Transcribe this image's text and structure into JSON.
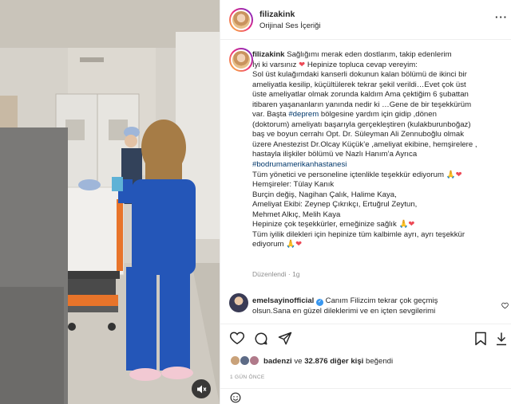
{
  "post": {
    "username": "filizakink",
    "audio": "Orijinal Ses İçeriği",
    "more_label": "···"
  },
  "caption": {
    "username": "filizakink",
    "lines": [
      " Sağlığımı merak eden dostlarım, takip edenlerim",
      "İyi ki varsınız ",
      " Hepinize topluca cevap vereyim:",
      "Sol üst kulağımdaki kanserli dokunun kalan bölümü de ikinci bir",
      "ameliyatla kesilip, küçültülerek tekrar şekil verildi…Evet çok üst",
      "üste ameliyatlar olmak zorunda kaldım Ama çektiğim 6 şubattan",
      "itibaren yaşananların yanında nedir ki …Gene de bir teşekkürüm",
      "var. Başta ",
      "#deprem",
      " bölgesine yardım için gidip ,dönen",
      "(doktorum) ameliyatı başarıyla gerçekleştiren (kulakburunboğaz)",
      "baş ve boyun cerrahı Opt. Dr. Süleyman Ali Zennuboğlu olmak",
      "üzere Anestezist Dr.Olcay Küçük’e ,ameliyat ekibine, hemşirelere ,",
      "hastayla ilişkiler bölümü ve Nazlı Hanım’a Ayrıca",
      "#bodrumamerikanhastanesi",
      "Tüm yönetici ve personeline içtenlikle teşekkür ediyorum ",
      "Hemşireler: Tülay Kanık",
      "Burçin değiş, Nagihan Çalık, Halime Kaya,",
      "Ameliyat Ekibi: Zeynep Çıkrıkçı, Ertuğrul Zeytun,",
      "Mehmet Alkıç, Melih Kaya",
      "Hepinize çok teşekkürler, emeğinize sağlık ",
      "Tüm iyilik dilekleri için hepinize tüm kalbimle ayrı, ayrı teşekkür",
      "ediyorum "
    ],
    "edited_label": "Düzenlendi · 1g"
  },
  "comment": {
    "username": "emelsayinofficial",
    "line1": " Canım Filizcim tekrar çok geçmiş",
    "line2": "olsun.Sana en güzel dileklerimi ve en içten sevgilerimi"
  },
  "likes": {
    "first_user": "badenzi",
    "connector": " ve ",
    "others": "32.876 diğer kişi",
    "suffix": " beğendi"
  },
  "timestamp": "1 GÜN ÖNCE",
  "icons": {
    "like": "heart-icon",
    "comment": "comment-icon",
    "share": "share-icon",
    "save": "bookmark-icon",
    "mute": "speaker-muted-icon",
    "emoji": "smiley-icon"
  },
  "colors": {
    "hashtag": "#00376b",
    "heart": "#ed4956",
    "verified": "#3897f0",
    "scrubs": "#2456b8"
  }
}
